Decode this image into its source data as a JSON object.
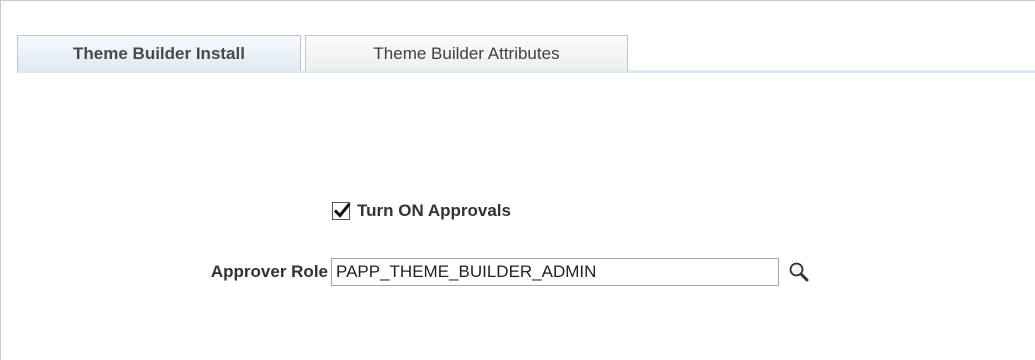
{
  "tabs": [
    {
      "label": "Theme Builder Install",
      "active": true
    },
    {
      "label": "Theme Builder Attributes",
      "active": false
    }
  ],
  "approvals": {
    "checkbox_label": "Turn ON Approvals",
    "checked": true
  },
  "approver_role": {
    "label": "Approver Role",
    "value": "PAPP_THEME_BUILDER_ADMIN"
  },
  "icons": {
    "lookup": "magnifying-glass",
    "checkmark": "checkmark"
  }
}
